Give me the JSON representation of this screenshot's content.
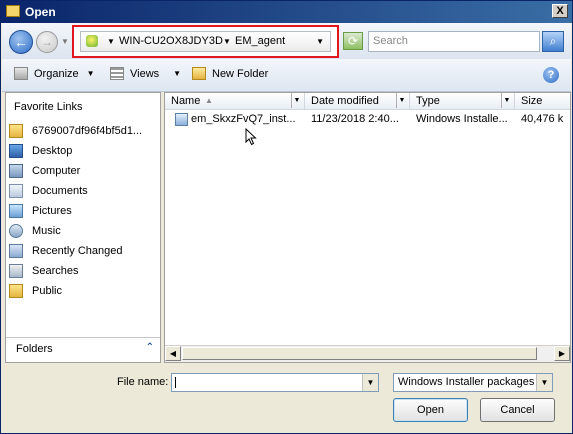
{
  "window": {
    "title": "Open",
    "close_label": "X"
  },
  "navigation": {
    "back_glyph": "←",
    "forward_glyph": "→",
    "address_crumbs": [
      "WIN-CU2OX8JDY3D",
      "EM_agent"
    ],
    "search_placeholder": "Search"
  },
  "toolbar": {
    "organize_label": "Organize",
    "views_label": "Views",
    "new_folder_label": "New Folder"
  },
  "sidebar": {
    "favorites_title": "Favorite Links",
    "items": [
      {
        "label": "6769007df96f4bf5d1...",
        "icon": "folder-icon"
      },
      {
        "label": "Desktop",
        "icon": "desktop-icon"
      },
      {
        "label": "Computer",
        "icon": "computer-icon"
      },
      {
        "label": "Documents",
        "icon": "documents-icon"
      },
      {
        "label": "Pictures",
        "icon": "pictures-icon"
      },
      {
        "label": "Music",
        "icon": "music-icon"
      },
      {
        "label": "Recently Changed",
        "icon": "recent-icon"
      },
      {
        "label": "Searches",
        "icon": "searches-icon"
      },
      {
        "label": "Public",
        "icon": "folder-icon"
      }
    ],
    "folders_label": "Folders"
  },
  "file_list": {
    "columns": [
      "Name",
      "Date modified",
      "Type",
      "Size"
    ],
    "rows": [
      {
        "name": "em_SkxzFvQ7_inst...",
        "date": "11/23/2018 2:40...",
        "type": "Windows Installe...",
        "size": "40,476 k"
      }
    ]
  },
  "bottom": {
    "file_name_label": "File name:",
    "file_name_value": "",
    "file_type_value": "Windows Installer packages (",
    "open_label": "Open",
    "cancel_label": "Cancel"
  },
  "colors": {
    "highlight_border": "#e2171d",
    "title_bar": "#0a246a"
  }
}
